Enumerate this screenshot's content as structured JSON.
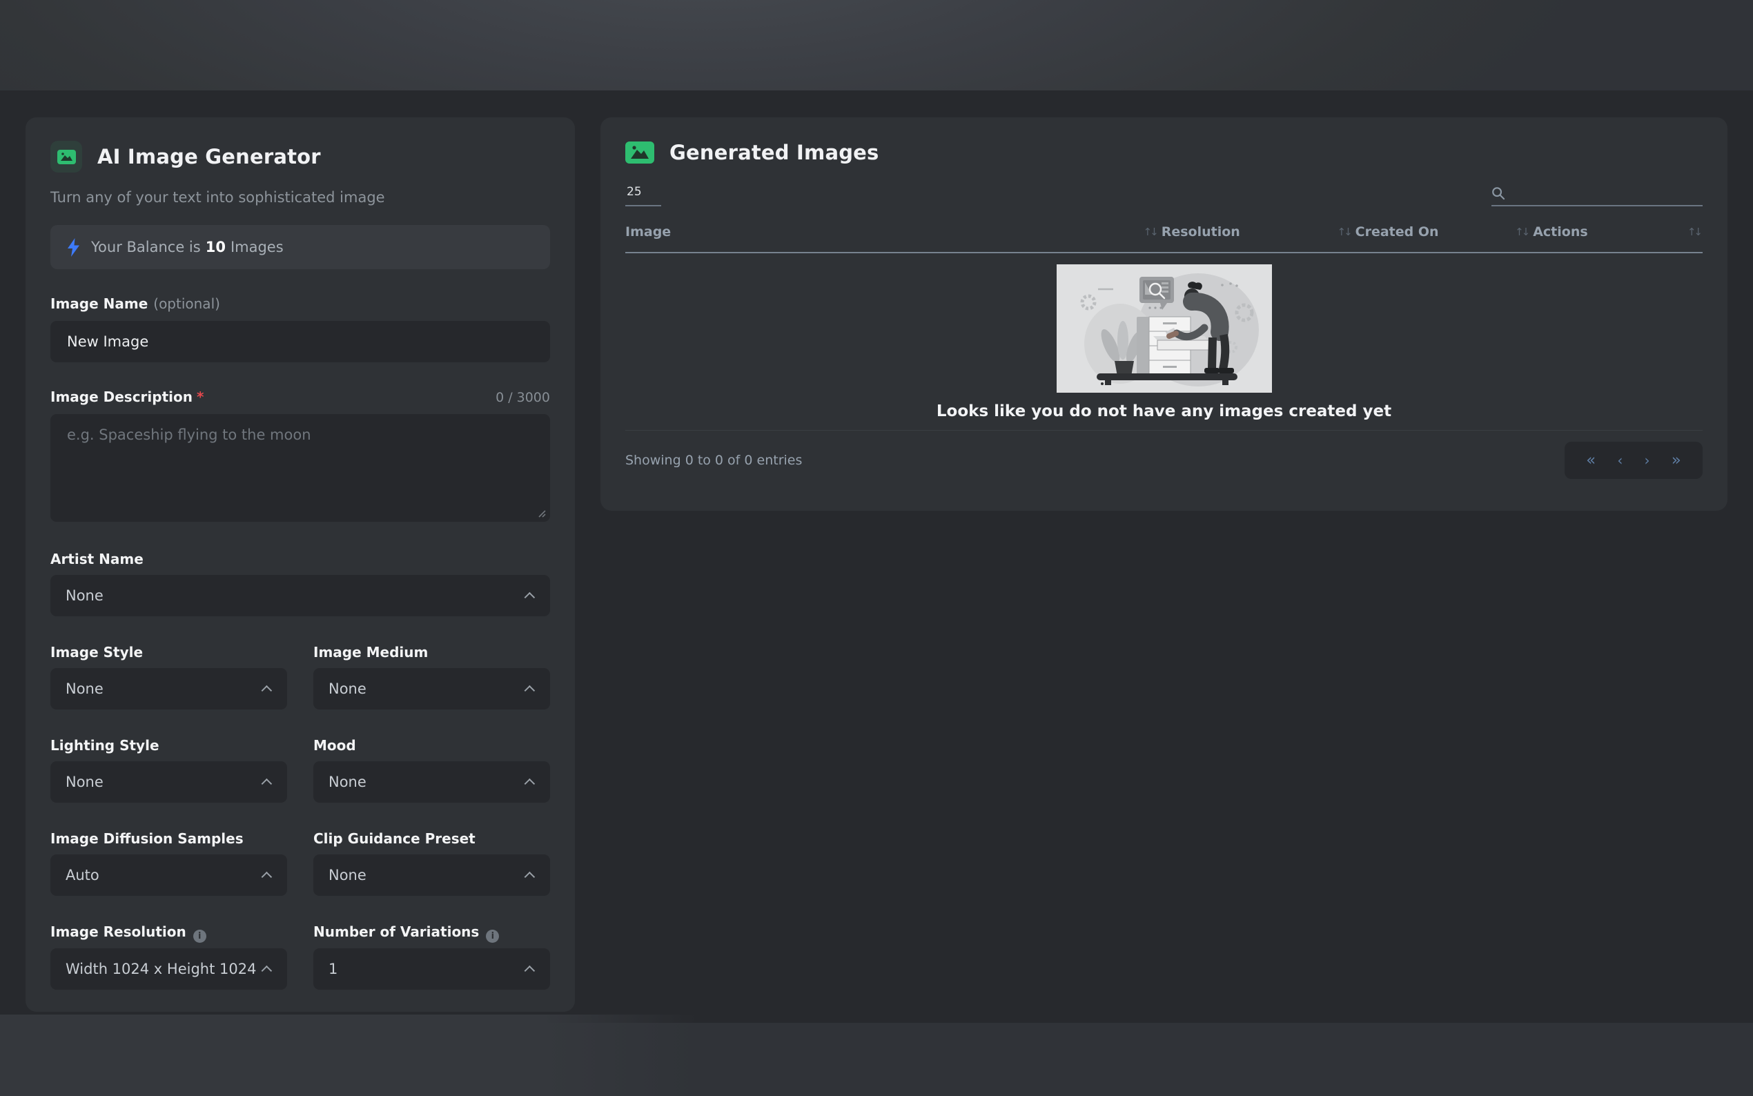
{
  "generator": {
    "title": "AI Image Generator",
    "subtitle": "Turn any of your text into sophisticated image",
    "balance": {
      "prefix": "Your Balance is",
      "amount": "10",
      "suffix": "Images"
    },
    "fields": {
      "image_name": {
        "label": "Image Name",
        "optional": "(optional)",
        "value": "New Image"
      },
      "image_description": {
        "label": "Image Description",
        "required_mark": "*",
        "counter": "0 / 3000",
        "placeholder": "e.g. Spaceship flying to the moon"
      },
      "artist_name": {
        "label": "Artist Name",
        "value": "None"
      },
      "image_style": {
        "label": "Image Style",
        "value": "None"
      },
      "image_medium": {
        "label": "Image Medium",
        "value": "None"
      },
      "lighting_style": {
        "label": "Lighting Style",
        "value": "None"
      },
      "mood": {
        "label": "Mood",
        "value": "None"
      },
      "diffusion_samples": {
        "label": "Image Diffusion Samples",
        "value": "Auto"
      },
      "clip_guidance": {
        "label": "Clip Guidance Preset",
        "value": "None"
      },
      "resolution": {
        "label": "Image Resolution",
        "info": "i",
        "value": "Width 1024 x Height 1024"
      },
      "variations": {
        "label": "Number of Variations",
        "info": "i",
        "value": "1"
      }
    }
  },
  "generated": {
    "title": "Generated Images",
    "page_size": "25",
    "search_value": "",
    "columns": [
      "Image",
      "Resolution",
      "Created On",
      "Actions"
    ],
    "sort_glyph": "↑↓",
    "empty_text": "Looks like you do not have any images created yet",
    "footer": "Showing 0 to 0 of 0 entries",
    "pagination": {
      "first": "«",
      "prev": "‹",
      "next": "›",
      "last": "»"
    }
  },
  "colors": {
    "accent_green": "#2ebd70",
    "accent_blue": "#3e7bfa",
    "required_red": "#e5484d",
    "pager_blue": "#5e7da3"
  }
}
